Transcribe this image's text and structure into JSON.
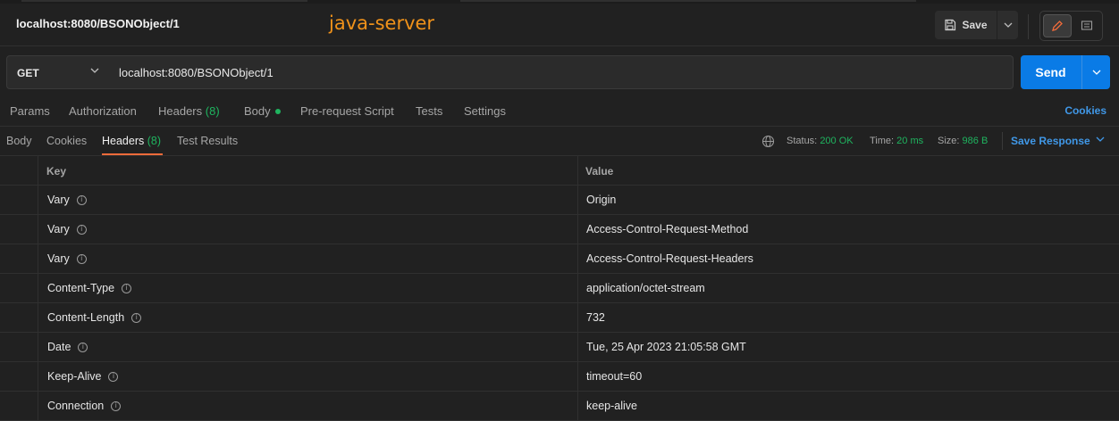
{
  "header": {
    "request_title": "localhost:8080/BSONObject/1",
    "annotation": "java-server",
    "save_label": "Save"
  },
  "request": {
    "method": "GET",
    "url": "localhost:8080/BSONObject/1",
    "send_label": "Send"
  },
  "request_tabs": {
    "params": "Params",
    "authorization": "Authorization",
    "headers": "Headers",
    "headers_count": "(8)",
    "body": "Body",
    "pre_request": "Pre-request Script",
    "tests": "Tests",
    "settings": "Settings",
    "cookies": "Cookies"
  },
  "response": {
    "tabs": {
      "body": "Body",
      "cookies": "Cookies",
      "headers": "Headers",
      "headers_count": "(8)",
      "test_results": "Test Results"
    },
    "status_label": "Status:",
    "status_value": "200 OK",
    "time_label": "Time:",
    "time_value": "20 ms",
    "size_label": "Size:",
    "size_value": "986 B",
    "save_response": "Save Response"
  },
  "table": {
    "key_header": "Key",
    "value_header": "Value",
    "rows": [
      {
        "key": "Vary",
        "value": "Origin"
      },
      {
        "key": "Vary",
        "value": "Access-Control-Request-Method"
      },
      {
        "key": "Vary",
        "value": "Access-Control-Request-Headers"
      },
      {
        "key": "Content-Type",
        "value": "application/octet-stream"
      },
      {
        "key": "Content-Length",
        "value": "732"
      },
      {
        "key": "Date",
        "value": "Tue, 25 Apr 2023 21:05:58 GMT"
      },
      {
        "key": "Keep-Alive",
        "value": "timeout=60"
      },
      {
        "key": "Connection",
        "value": "keep-alive"
      }
    ]
  },
  "colors": {
    "accent_send": "#0a7be6",
    "status_green": "#1fb45f",
    "annotation_orange": "#f0921a",
    "active_tab_underline": "#f26b3a",
    "link_blue": "#4098e8"
  }
}
